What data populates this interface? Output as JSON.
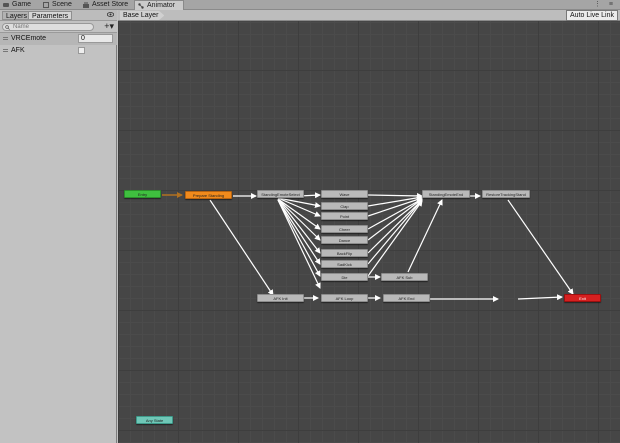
{
  "tabs": [
    {
      "label": "Game",
      "icon": "game-icon"
    },
    {
      "label": "Scene",
      "icon": "scene-icon"
    },
    {
      "label": "Asset Store",
      "icon": "store-icon"
    },
    {
      "label": "Animator",
      "icon": "animator-icon"
    }
  ],
  "window_controls": "⋮ ≡",
  "left_panel": {
    "tabs": [
      "Layers",
      "Parameters"
    ],
    "search_placeholder": "Name",
    "add_label": "+▾",
    "parameters": [
      {
        "name": "VRCEmote",
        "type": "int",
        "value": "0"
      },
      {
        "name": "AFK",
        "type": "bool",
        "value": false
      }
    ]
  },
  "graph": {
    "breadcrumb": "Base Layer",
    "live_link_label": "Auto Live Link",
    "nodes": {
      "entry": "Entry",
      "default": "Prepare Standing",
      "emote_select": "StandingEmoteSelect",
      "emote_1": "Wave",
      "emote_2": "Clap",
      "emote_3": "Point",
      "emote_4": "Cheer",
      "emote_5": "Dance",
      "emote_6": "BackFlip",
      "emote_7": "SadKick",
      "emote_8": "Die",
      "afk_sub": "AFK Sub",
      "emote_end": "StandingEmoteEnd",
      "restore": "RestoreTrackingStand",
      "exit": "Exit",
      "afk_init": "AFK Init",
      "afk_loop": "AFK Loop",
      "afk_end": "AFK End",
      "any_state": "Any State"
    }
  },
  "colors": {
    "entry": "#3fc03f",
    "default_state": "#f08a1c",
    "exit": "#d52020",
    "any_state": "#6fc7b7",
    "state": "#b9b9b9",
    "graph_bg": "#464646"
  }
}
